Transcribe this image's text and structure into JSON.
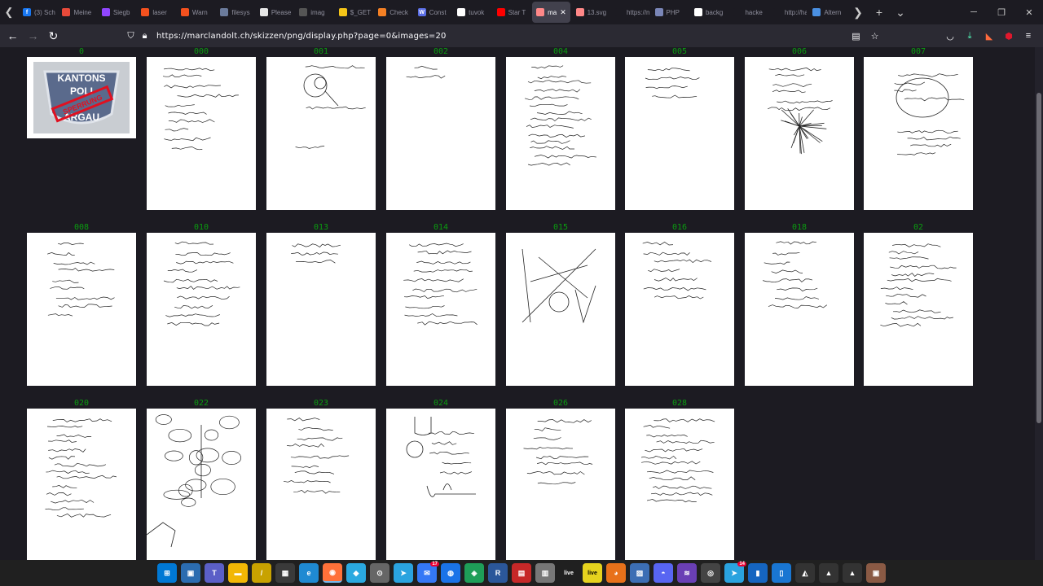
{
  "tabs": [
    {
      "label": "(3) Sch",
      "fav": "f",
      "color": "#1877f2"
    },
    {
      "label": "Meine",
      "fav": "",
      "color": "#e84a3a"
    },
    {
      "label": "Siegb",
      "fav": "",
      "color": "#9146ff"
    },
    {
      "label": "laser",
      "fav": "",
      "color": "#f4511e"
    },
    {
      "label": "Warn",
      "fav": "",
      "color": "#f4511e"
    },
    {
      "label": "filesys",
      "fav": "",
      "color": "#6b7b9c"
    },
    {
      "label": "Please",
      "fav": "",
      "color": "#e6e6e6"
    },
    {
      "label": "imag",
      "fav": "",
      "color": "#555555"
    },
    {
      "label": "$_GET",
      "fav": "",
      "color": "#f5c518"
    },
    {
      "label": "Check",
      "fav": "",
      "color": "#f48024"
    },
    {
      "label": "Const",
      "fav": "W",
      "color": "#5a6ee6"
    },
    {
      "label": "tuvok",
      "fav": "G",
      "color": "#ffffff"
    },
    {
      "label": "Star T",
      "fav": "",
      "color": "#ff0000"
    },
    {
      "label": "ma",
      "fav": "",
      "color": "#ff8888",
      "active": true
    },
    {
      "label": "13.svg",
      "fav": "",
      "color": "#ff8888"
    },
    {
      "label": "https://ma",
      "fav": "",
      "color": "#1c1b22"
    },
    {
      "label": "PHP",
      "fav": "",
      "color": "#7a86b8"
    },
    {
      "label": "backg",
      "fav": "",
      "color": "#ffffff"
    },
    {
      "label": "hacke",
      "fav": "",
      "color": "#1c1b22"
    },
    {
      "label": "http://ha",
      "fav": "",
      "color": "#1c1b22"
    },
    {
      "label": "Altern",
      "fav": "",
      "color": "#4a90e2"
    }
  ],
  "url": "https://marclandolt.ch/skizzen/png/display.php?page=0&images=20",
  "thumbnails": [
    {
      "label": "0",
      "kind": "logo",
      "logo_top": "KANTONS",
      "logo_mid": "POLI",
      "logo_bottom": "ARGAU",
      "stamp": "SPERRUNG"
    },
    {
      "label": "000",
      "kind": "notes",
      "lines": 10
    },
    {
      "label": "001",
      "kind": "diagram",
      "lines": 3
    },
    {
      "label": "002",
      "kind": "notes",
      "lines": 2
    },
    {
      "label": "004",
      "kind": "notes",
      "lines": 14
    },
    {
      "label": "005",
      "kind": "notes",
      "lines": 4
    },
    {
      "label": "006",
      "kind": "tree",
      "lines": 6
    },
    {
      "label": "007",
      "kind": "mindmap",
      "lines": 8
    },
    {
      "label": "008",
      "kind": "notes",
      "lines": 9
    },
    {
      "label": "010",
      "kind": "notes",
      "lines": 10
    },
    {
      "label": "013",
      "kind": "notes",
      "lines": 3
    },
    {
      "label": "014",
      "kind": "notes",
      "lines": 10
    },
    {
      "label": "015",
      "kind": "sketch",
      "lines": 2
    },
    {
      "label": "016",
      "kind": "notes",
      "lines": 7
    },
    {
      "label": "018",
      "kind": "notes",
      "lines": 8
    },
    {
      "label": "02",
      "kind": "notes",
      "lines": 12
    },
    {
      "label": "020",
      "kind": "notes",
      "lines": 14
    },
    {
      "label": "022",
      "kind": "bubbles",
      "lines": 0
    },
    {
      "label": "023",
      "kind": "notes",
      "lines": 9
    },
    {
      "label": "024",
      "kind": "sketch2",
      "lines": 5
    },
    {
      "label": "026",
      "kind": "notes",
      "lines": 8
    },
    {
      "label": "028",
      "kind": "notes",
      "lines": 12
    }
  ],
  "taskbar": [
    {
      "name": "start",
      "glyph": "⊞",
      "color": "#0078d4"
    },
    {
      "name": "taskview",
      "glyph": "▣",
      "color": "#2b6cb0"
    },
    {
      "name": "teams",
      "glyph": "T",
      "color": "#5b5fc7"
    },
    {
      "name": "explorer",
      "glyph": "▬",
      "color": "#f2b705"
    },
    {
      "name": "pen",
      "glyph": "/",
      "color": "#c8a200"
    },
    {
      "name": "app1",
      "glyph": "▦",
      "color": "#3a3a3a"
    },
    {
      "name": "edge",
      "glyph": "e",
      "color": "#1f8ad2"
    },
    {
      "name": "firefox",
      "glyph": "◉",
      "color": "#ff7139",
      "active": true
    },
    {
      "name": "app2",
      "glyph": "◆",
      "color": "#2aa9e0"
    },
    {
      "name": "app3",
      "glyph": "⊙",
      "color": "#666666"
    },
    {
      "name": "telegram",
      "glyph": "➤",
      "color": "#2aa3df"
    },
    {
      "name": "app4",
      "glyph": "✉",
      "color": "#3478f6",
      "badge": "17"
    },
    {
      "name": "app5",
      "glyph": "◍",
      "color": "#1a73e8"
    },
    {
      "name": "app6",
      "glyph": "◈",
      "color": "#1e9e58"
    },
    {
      "name": "app7",
      "glyph": "R",
      "color": "#2b579a"
    },
    {
      "name": "app8",
      "glyph": "▤",
      "color": "#c62828"
    },
    {
      "name": "app9",
      "glyph": "▥",
      "color": "#777777"
    },
    {
      "name": "live",
      "glyph": "live",
      "color": "#202020"
    },
    {
      "name": "live2",
      "glyph": "live",
      "color": "#e6d31e"
    },
    {
      "name": "app10",
      "glyph": "◕",
      "color": "#e8711a"
    },
    {
      "name": "app11",
      "glyph": "▨",
      "color": "#3c6eb4"
    },
    {
      "name": "discord",
      "glyph": "◓",
      "color": "#5865f2"
    },
    {
      "name": "app12",
      "glyph": "≋",
      "color": "#6a3fb5"
    },
    {
      "name": "app13",
      "glyph": "◎",
      "color": "#444444"
    },
    {
      "name": "app14",
      "glyph": "➤",
      "color": "#2aa3df",
      "badge": "14"
    },
    {
      "name": "app15",
      "glyph": "▮",
      "color": "#1565c0"
    },
    {
      "name": "app16",
      "glyph": "▯",
      "color": "#1976d2"
    },
    {
      "name": "app17",
      "glyph": "◭",
      "color": "#333333"
    },
    {
      "name": "app18",
      "glyph": "▲",
      "color": "#333333"
    },
    {
      "name": "app19",
      "glyph": "▲",
      "color": "#333333"
    },
    {
      "name": "app20",
      "glyph": "▣",
      "color": "#8a5a44"
    }
  ]
}
